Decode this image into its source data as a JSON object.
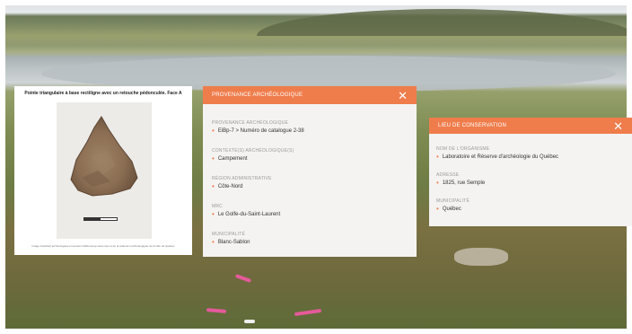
{
  "image_card": {
    "caption": "Pointe triangulaire à base rectiligne avec un retouche pédonculée. Face A",
    "credit": "Image d'artefact archéologique provenant d'Ethnoscop-Aecomps et de la collection archéologique de la Ville de Québec"
  },
  "provenance_panel": {
    "title": "PROVENANCE ARCHÉOLOGIQUE",
    "fields": [
      {
        "label": "PROVENANCE ARCHÉOLOGIQUE",
        "value": "EiBp-7 > Numéro de catalogue 2-38"
      },
      {
        "label": "CONTEXTE(S) ARCHÉOLOGIQUE(S)",
        "value": "Campement"
      },
      {
        "label": "RÉGION ADMINISTRATIVE",
        "value": "Côte-Nord"
      },
      {
        "label": "MRC",
        "value": "Le Golfe-du-Saint-Laurent"
      },
      {
        "label": "MUNICIPALITÉ",
        "value": "Blanc-Sablon"
      }
    ]
  },
  "conservation_panel": {
    "title": "LIEU DE CONSERVATION",
    "fields": [
      {
        "label": "NOM DE L'ORGANISME",
        "value": "Laboratoire et Réserve d'archéologie du Québec"
      },
      {
        "label": "ADRESSE",
        "value": "1825, rue Semple"
      },
      {
        "label": "MUNICIPALITÉ",
        "value": "Québec"
      }
    ]
  },
  "colors": {
    "accent": "#ef7d4c",
    "panel_bg": "#f4f3f2",
    "bullet": "#ef7d4c"
  },
  "icons": {
    "close": "close-icon",
    "bullet": "bullet-icon"
  }
}
